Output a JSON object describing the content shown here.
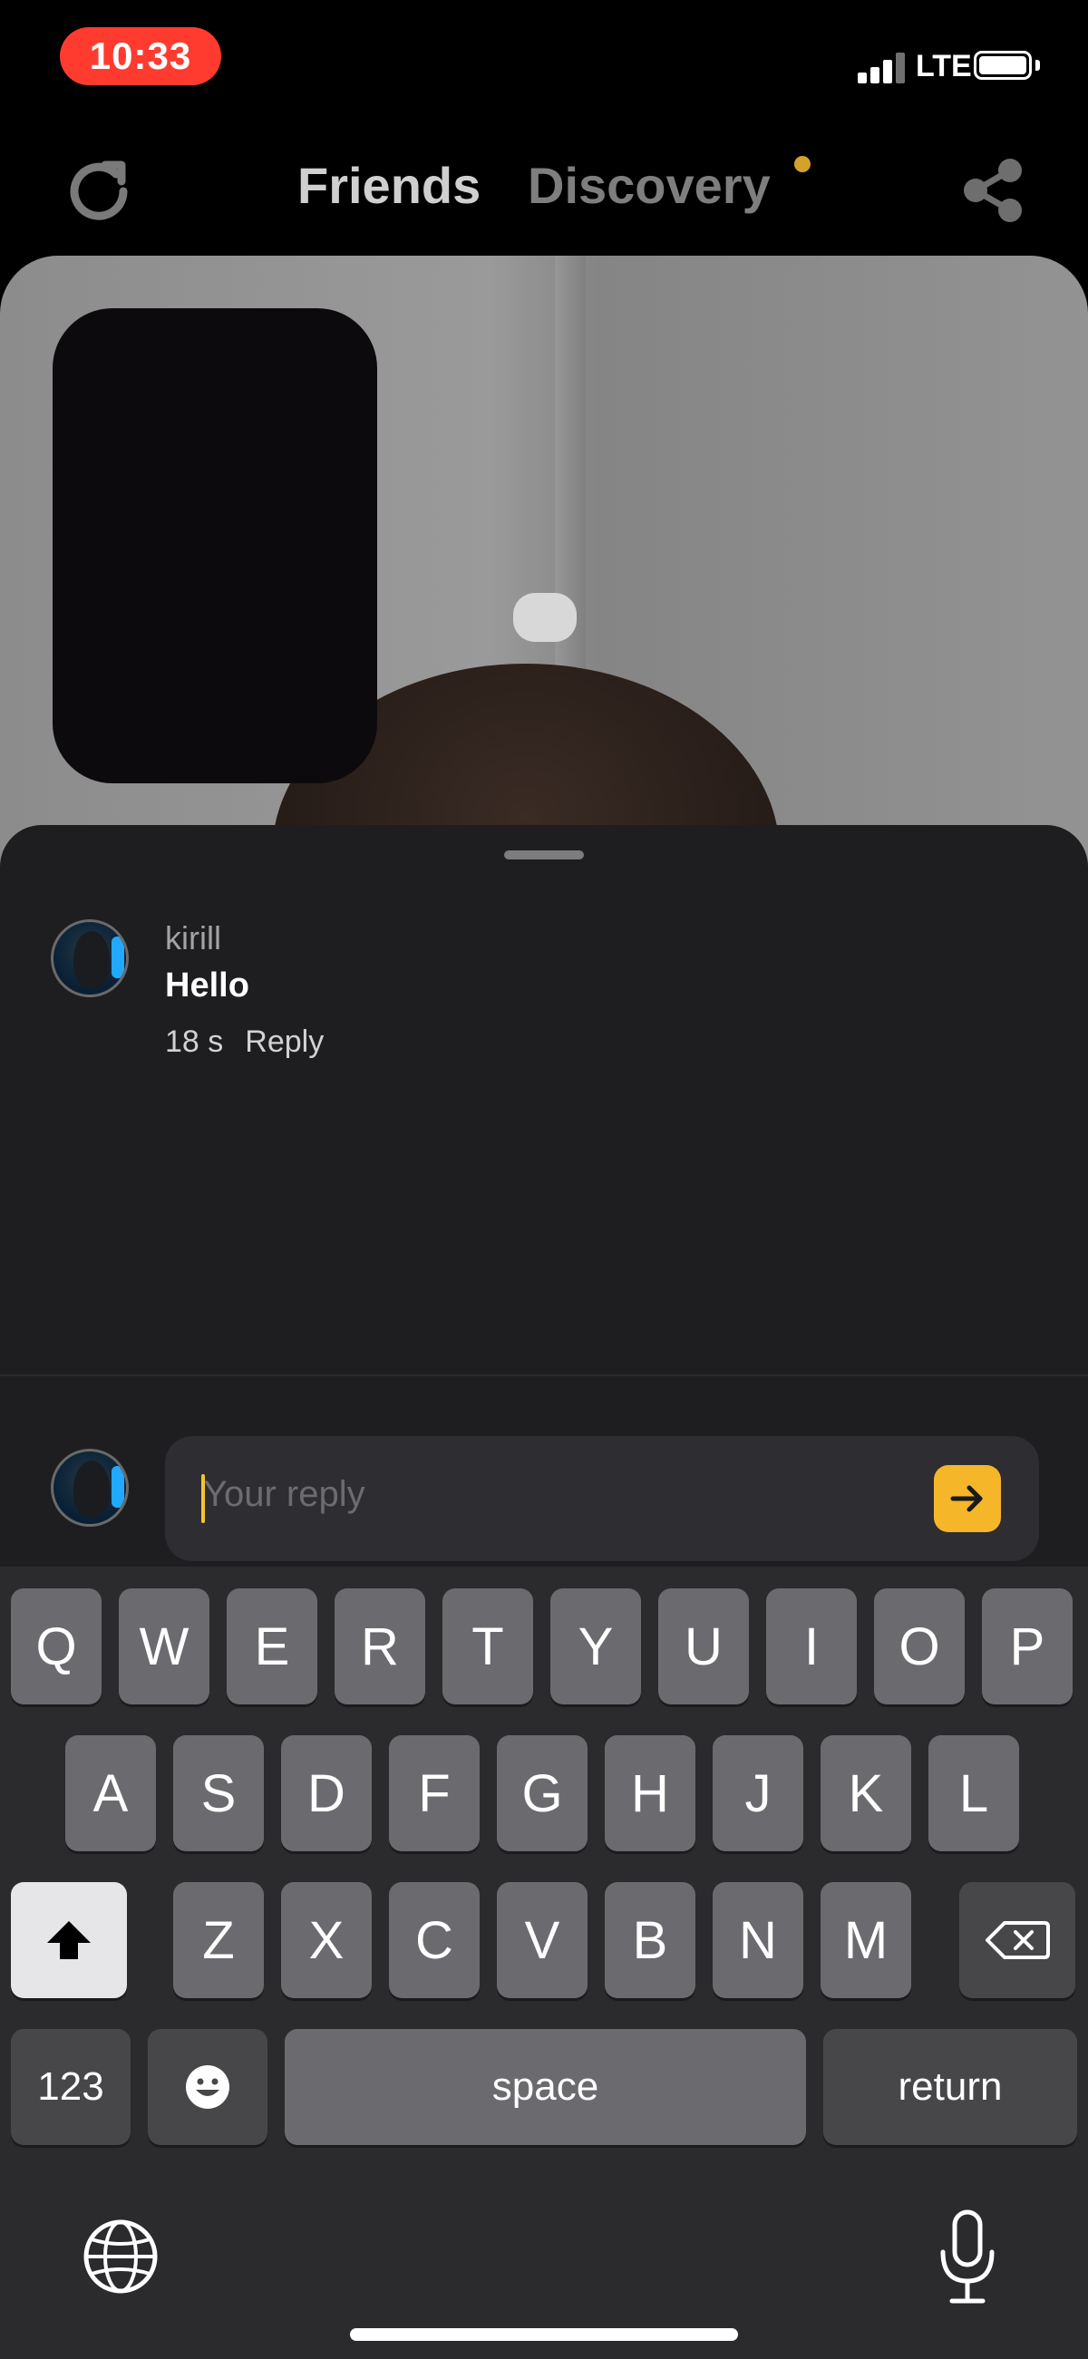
{
  "status_bar": {
    "time": "10:33",
    "network": "LTE"
  },
  "nav": {
    "tabs": [
      "Friends",
      "Discovery"
    ],
    "active_tab": "Friends",
    "discovery_has_badge": true,
    "refresh_icon": "refresh-icon",
    "share_icon": "share-icon"
  },
  "comments": [
    {
      "user": "kirill",
      "text": "Hello",
      "age": "18 s",
      "reply_label": "Reply"
    }
  ],
  "reply_box": {
    "placeholder": "Your reply",
    "send_icon": "arrow-right-icon"
  },
  "keyboard": {
    "row1": [
      "Q",
      "W",
      "E",
      "R",
      "T",
      "Y",
      "U",
      "I",
      "O",
      "P"
    ],
    "row2": [
      "A",
      "S",
      "D",
      "F",
      "G",
      "H",
      "J",
      "K",
      "L"
    ],
    "row3": [
      "Z",
      "X",
      "C",
      "V",
      "B",
      "N",
      "M"
    ],
    "numbers_label": "123",
    "space_label": "space",
    "return_label": "return",
    "emoji_icon": "emoji-icon",
    "shift_icon": "shift-icon",
    "delete_icon": "backspace-icon",
    "globe_icon": "globe-icon",
    "mic_icon": "microphone-icon"
  },
  "colors": {
    "accent": "#f6b62a",
    "badge": "#d4a12a",
    "time_pill": "#ff3b30",
    "sheet_bg": "#1e1d20"
  }
}
